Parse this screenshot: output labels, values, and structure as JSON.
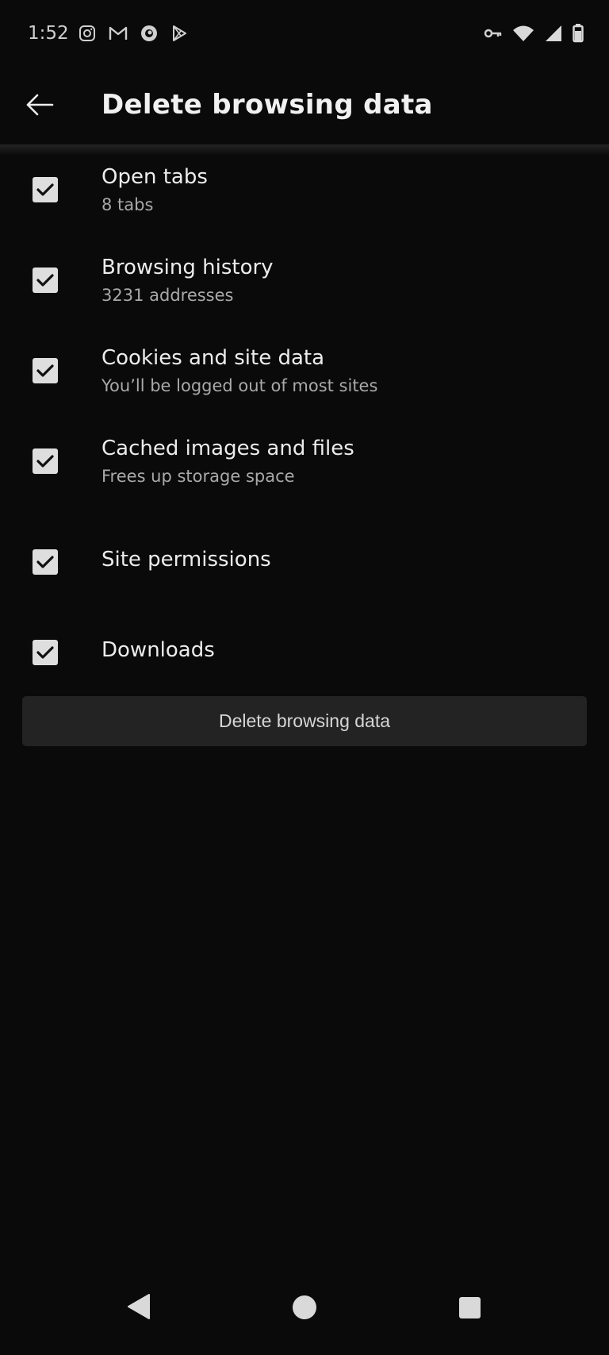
{
  "status_bar": {
    "time": "1:52",
    "left_icons": [
      "instagram-icon",
      "gmail-icon",
      "app-icon",
      "play-store-icon"
    ],
    "right_icons": [
      "vpn-key-icon",
      "wifi-icon",
      "signal-icon",
      "battery-icon"
    ]
  },
  "app_bar": {
    "title": "Delete browsing data"
  },
  "options": [
    {
      "label": "Open tabs",
      "detail": "8 tabs",
      "checked": true
    },
    {
      "label": "Browsing history",
      "detail": "3231 addresses",
      "checked": true
    },
    {
      "label": "Cookies and site data",
      "detail": "You’ll be logged out of most sites",
      "checked": true
    },
    {
      "label": "Cached images and files",
      "detail": "Frees up storage space",
      "checked": true
    },
    {
      "label": "Site permissions",
      "checked": true
    },
    {
      "label": "Downloads",
      "checked": true
    }
  ],
  "actions": {
    "delete_label": "Delete browsing data"
  },
  "colors": {
    "background": "#0a0a0a",
    "checkbox": "#dedede",
    "button": "#232323"
  }
}
